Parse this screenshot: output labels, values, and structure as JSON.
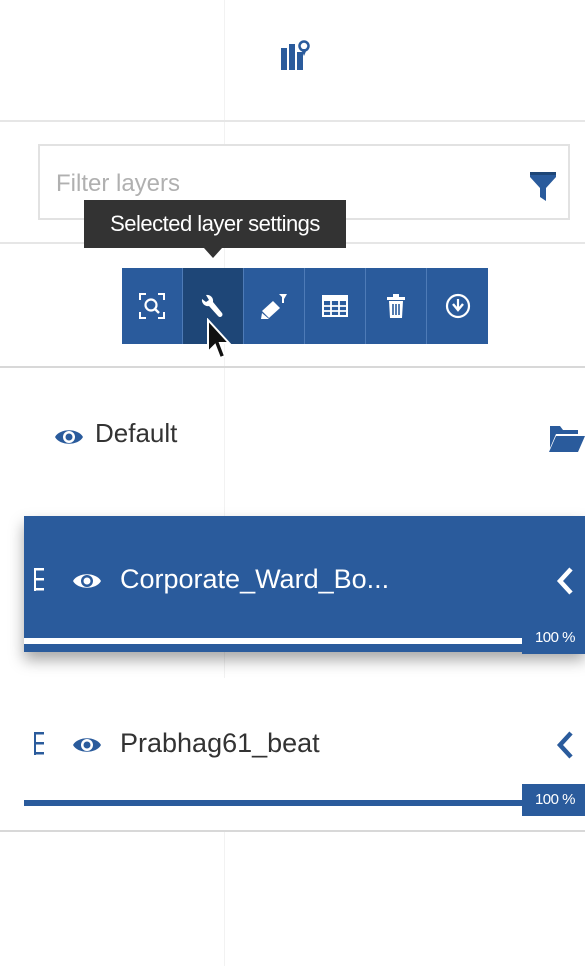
{
  "header": {
    "icon": "map-layers-icon"
  },
  "filter": {
    "placeholder": "Filter layers",
    "icon": "filter-icon"
  },
  "tooltip": {
    "text": "Selected layer settings"
  },
  "toolbar": {
    "buttons": [
      {
        "name": "zoom-to-layer",
        "icon": "zoom-extent-icon"
      },
      {
        "name": "layer-settings",
        "icon": "wrench-icon",
        "active": true
      },
      {
        "name": "style-editor",
        "icon": "paint-icon"
      },
      {
        "name": "attribute-table",
        "icon": "table-icon"
      },
      {
        "name": "delete-layer",
        "icon": "trash-icon"
      },
      {
        "name": "download-layer",
        "icon": "download-icon"
      }
    ]
  },
  "group": {
    "label": "Default",
    "icon": "folder-open-icon"
  },
  "layers": [
    {
      "label": "Corporate_Ward_Bo...",
      "opacity": "100 %",
      "opacity_value": 1.0,
      "selected": true
    },
    {
      "label": "Prabhag61_beat",
      "opacity": "100 %",
      "opacity_value": 1.0,
      "selected": false
    }
  ],
  "colors": {
    "accent": "#2a5b9c",
    "active": "#1e4677",
    "tooltip": "#333333"
  }
}
